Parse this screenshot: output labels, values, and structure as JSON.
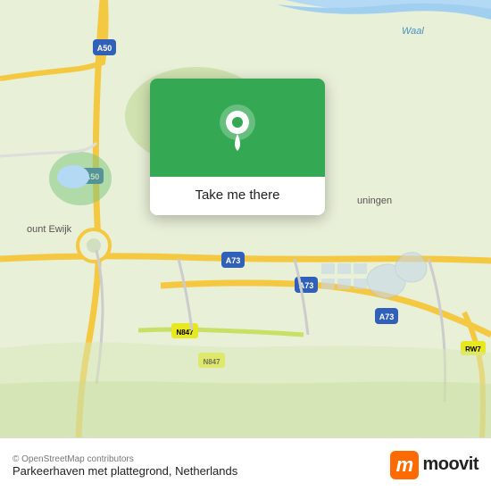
{
  "map": {
    "alt": "Map of Netherlands showing Parkeerhaven met plattegrond location"
  },
  "tooltip": {
    "label": "Take me there"
  },
  "bottom_bar": {
    "osm_credit": "© OpenStreetMap contributors",
    "location_name": "Parkeerhaven met plattegrond, Netherlands",
    "moovit_letter": "m",
    "moovit_word": "moovit"
  }
}
